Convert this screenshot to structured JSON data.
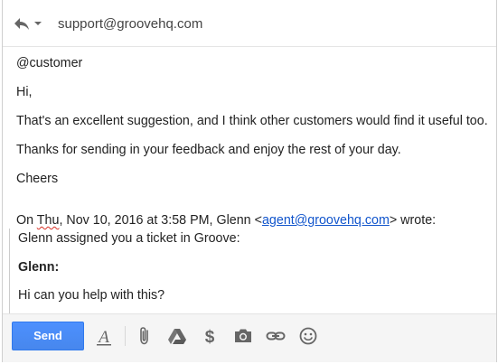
{
  "header": {
    "to_address": "support@groovehq.com",
    "reply_icon": "reply-icon",
    "dropdown_icon": "chevron-down-icon"
  },
  "message": {
    "mention": "@customer",
    "greeting": "Hi,",
    "paragraph_1": "That's an excellent suggestion, and I think other customers would find it useful too.",
    "paragraph_2": "Thanks for sending in your feedback and enjoy the rest of your day.",
    "signoff": "Cheers"
  },
  "quote_header": {
    "prefix": "On ",
    "day": "Thu",
    "middle": ", Nov 10, 2016 at 3:58 PM, Glenn <",
    "email": "agent@groovehq.com",
    "suffix": "> wrote:"
  },
  "quoted": {
    "line_1": "Glenn assigned you a ticket in Groove:",
    "author": "Glenn:",
    "line_2": "Hi can you help with this?"
  },
  "toolbar": {
    "send_label": "Send",
    "icons": [
      "formatting-icon",
      "attach-icon",
      "drive-icon",
      "money-icon",
      "camera-icon",
      "link-icon",
      "emoji-icon"
    ],
    "accent": "#4d90fe",
    "icon_color": "#666666"
  }
}
